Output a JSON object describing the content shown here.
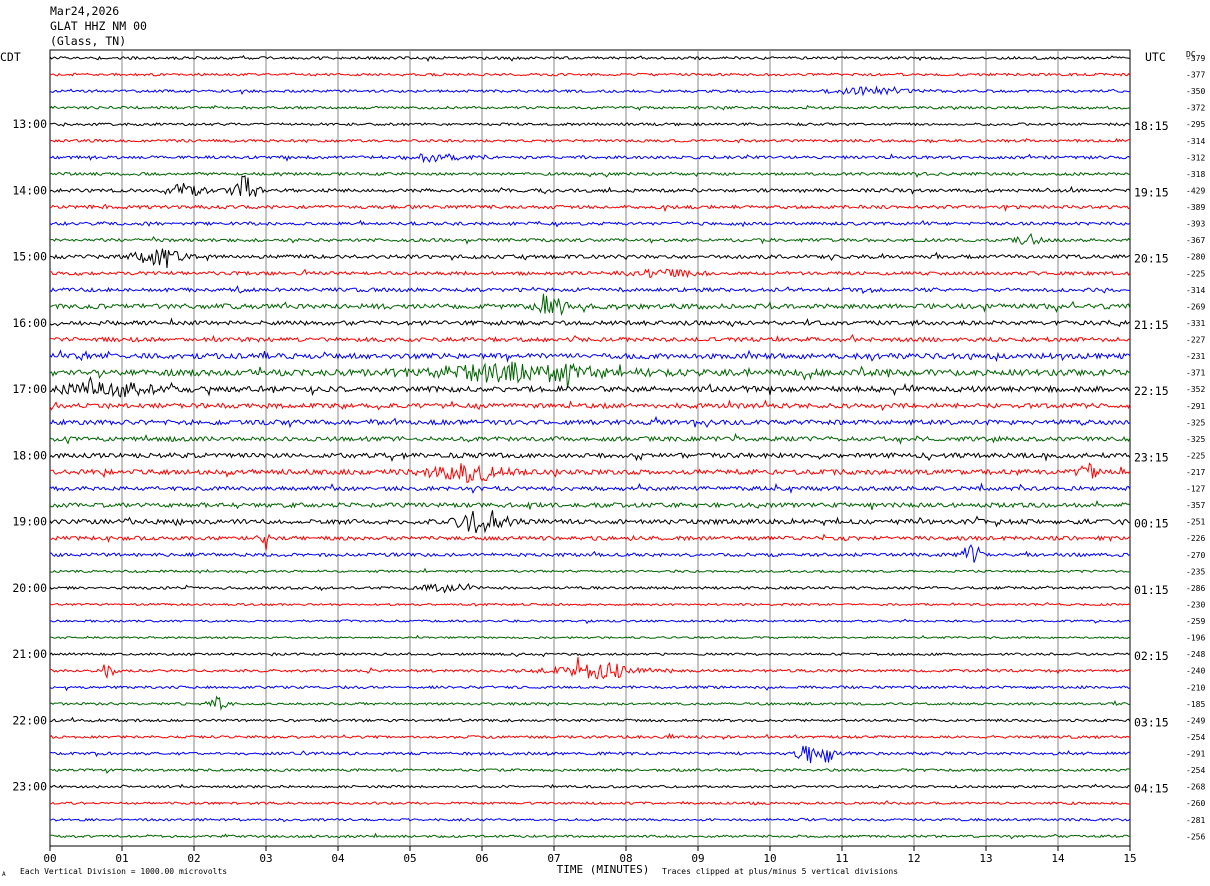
{
  "header": {
    "date": "Mar24,2026",
    "station": "GLAT HHZ NM 00",
    "location": "(Glass, TN)"
  },
  "left_tz": "CDT",
  "right_tz": "UTC",
  "dc_label": "DC",
  "footer": {
    "left_mark": "A",
    "scale_note": "Each Vertical Division = 1000.00 microvolts",
    "xlabel": "TIME (MINUTES)",
    "clip_note": "Traces clipped at plus/minus 5 vertical divisions"
  },
  "colors": {
    "trace_cycle": [
      "#000000",
      "#ff0000",
      "#0000ff",
      "#006400"
    ],
    "grid": "#888888"
  },
  "chart_data": {
    "type": "line",
    "title": "GLAT HHZ NM 00",
    "xlabel": "TIME (MINUTES)",
    "xlim": [
      0,
      15
    ],
    "x_ticks": [
      "00",
      "01",
      "02",
      "03",
      "04",
      "05",
      "06",
      "07",
      "08",
      "09",
      "10",
      "11",
      "12",
      "13",
      "14",
      "15"
    ],
    "left_hour_labels": [
      {
        "row": 4,
        "label": "13:00"
      },
      {
        "row": 8,
        "label": "14:00"
      },
      {
        "row": 12,
        "label": "15:00"
      },
      {
        "row": 16,
        "label": "16:00"
      },
      {
        "row": 20,
        "label": "17:00"
      },
      {
        "row": 24,
        "label": "18:00"
      },
      {
        "row": 28,
        "label": "19:00"
      },
      {
        "row": 32,
        "label": "20:00"
      },
      {
        "row": 36,
        "label": "21:00"
      },
      {
        "row": 40,
        "label": "22:00"
      },
      {
        "row": 44,
        "label": "23:00"
      }
    ],
    "right_hour_labels": [
      {
        "row": 4,
        "label": "18:15"
      },
      {
        "row": 8,
        "label": "19:15"
      },
      {
        "row": 12,
        "label": "20:15"
      },
      {
        "row": 16,
        "label": "21:15"
      },
      {
        "row": 20,
        "label": "22:15"
      },
      {
        "row": 24,
        "label": "23:15"
      },
      {
        "row": 28,
        "label": "00:15"
      },
      {
        "row": 32,
        "label": "01:15"
      },
      {
        "row": 36,
        "label": "02:15"
      },
      {
        "row": 40,
        "label": "03:15"
      },
      {
        "row": 44,
        "label": "04:15"
      }
    ],
    "dc_offsets": [
      "-379",
      "-377",
      "-350",
      "-372",
      "-295",
      "-314",
      "-312",
      "-318",
      "-429",
      "-389",
      "-393",
      "-367",
      "-280",
      "-225",
      "-314",
      "-269",
      "-331",
      "-227",
      "-231",
      "-371",
      "-352",
      "-291",
      "-325",
      "-325",
      "-225",
      "-217",
      "-127",
      "-357",
      "-251",
      "-226",
      "-270",
      "-235",
      "-286",
      "-230",
      "-259",
      "-196",
      "-248",
      "-240",
      "-210",
      "-185",
      "-249",
      "-254",
      "-291",
      "-254",
      "-268",
      "-260",
      "-281",
      "-256"
    ],
    "row_noise_levels": [
      1.0,
      1.0,
      1.0,
      1.0,
      1.0,
      1.0,
      1.1,
      1.1,
      1.3,
      1.3,
      1.2,
      1.2,
      1.4,
      1.3,
      1.4,
      1.9,
      1.7,
      1.6,
      2.0,
      2.4,
      2.1,
      1.8,
      1.8,
      1.7,
      1.8,
      1.9,
      1.6,
      1.7,
      1.8,
      1.5,
      1.3,
      0.9,
      1.0,
      0.8,
      0.8,
      0.7,
      0.9,
      1.0,
      1.0,
      0.9,
      1.0,
      1.0,
      1.1,
      1.0,
      0.9,
      0.9,
      0.9,
      0.9
    ],
    "events": [
      {
        "row": 2,
        "minute": 11.4,
        "amplitude": 3,
        "width": 0.5
      },
      {
        "row": 6,
        "minute": 5.3,
        "amplitude": 3,
        "width": 0.4
      },
      {
        "row": 8,
        "minute": 2.7,
        "amplitude": 16,
        "width": 0.15
      },
      {
        "row": 8,
        "minute": 1.9,
        "amplitude": 7,
        "width": 0.2
      },
      {
        "row": 11,
        "minute": 13.6,
        "amplitude": 5,
        "width": 0.15
      },
      {
        "row": 12,
        "minute": 1.5,
        "amplitude": 8,
        "width": 0.3
      },
      {
        "row": 13,
        "minute": 8.5,
        "amplitude": 3,
        "width": 0.5
      },
      {
        "row": 15,
        "minute": 7.0,
        "amplitude": 10,
        "width": 0.2
      },
      {
        "row": 19,
        "minute": 6.5,
        "amplitude": 8,
        "width": 1.2
      },
      {
        "row": 20,
        "minute": 0.8,
        "amplitude": 6,
        "width": 0.6
      },
      {
        "row": 25,
        "minute": 5.8,
        "amplitude": 8,
        "width": 0.5
      },
      {
        "row": 25,
        "minute": 14.4,
        "amplitude": 14,
        "width": 0.1
      },
      {
        "row": 28,
        "minute": 6.0,
        "amplitude": 12,
        "width": 0.3
      },
      {
        "row": 29,
        "minute": 3.0,
        "amplitude": 12,
        "width": 0.05
      },
      {
        "row": 30,
        "minute": 12.8,
        "amplitude": 15,
        "width": 0.1
      },
      {
        "row": 32,
        "minute": 5.5,
        "amplitude": 4,
        "width": 0.3
      },
      {
        "row": 37,
        "minute": 0.8,
        "amplitude": 9,
        "width": 0.08
      },
      {
        "row": 37,
        "minute": 7.6,
        "amplitude": 7,
        "width": 0.6
      },
      {
        "row": 39,
        "minute": 2.3,
        "amplitude": 6,
        "width": 0.15
      },
      {
        "row": 42,
        "minute": 10.5,
        "amplitude": 14,
        "width": 0.1
      },
      {
        "row": 42,
        "minute": 10.8,
        "amplitude": 12,
        "width": 0.08
      }
    ]
  }
}
